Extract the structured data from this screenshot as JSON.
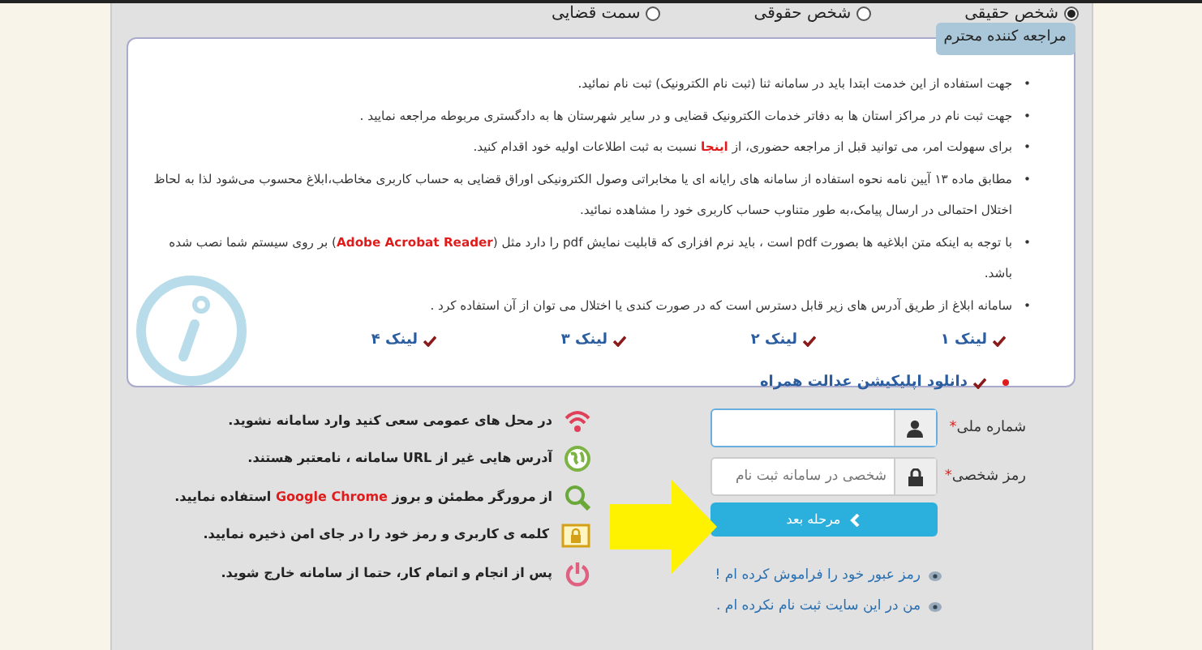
{
  "radios": [
    {
      "label": "شخص حقیقی",
      "selected": true
    },
    {
      "label": "شخص حقوقی",
      "selected": false
    },
    {
      "label": "سمت قضایی",
      "selected": false
    }
  ],
  "notice": {
    "title": "مراجعه کننده محترم",
    "bullet_marker": "•",
    "bullets": [
      {
        "text": "جهت استفاده از این خدمت ابتدا باید در سامانه ثنا (ثبت نام الکترونیک) ثبت نام نمائید."
      },
      {
        "text": "جهت ثبت نام در مراکز استان ها به دفاتر خدمات الکترونیک قضایی و در سایر شهرستان ها به دادگستری مربوطه مراجعه نمایید ."
      },
      {
        "text": "برای سهولت امر، می توانید قبل از مراجعه حضوری، از",
        "link": "اینجا",
        "text_after": "نسبت به ثبت اطلاعات اولیه خود اقدام کنید."
      },
      {
        "text": "مطابق ماده ۱۳ آیین نامه نحوه استفاده از سامانه های رایانه ای یا مخابراتی وصول الکترونیکی اوراق قضایی به حساب کاربری مخاطب،ابلاغ محسوب می‌شود لذا به لحاظ اختلال احتمالی در ارسال پیامک،به طور متناوب حساب کاربری خود را مشاهده نمائید."
      },
      {
        "text": "با توجه به اینکه متن ابلاغیه ها بصورت pdf است ، باید نرم افزاری که قابلیت نمایش pdf را دارد مثل (**Adobe Acrobat Reader**) بر روی سیستم شما نصب شده باشد."
      },
      {
        "text": "سامانه ابلاغ از طریق آدرس های زیر قابل دسترس است که در صورت کندی یا اختلال می توان از آن استفاده کرد ."
      }
    ],
    "links": [
      "لینک ۱",
      "لینک ۲",
      "لینک ۳",
      "لینک ۴"
    ],
    "app_link": "دانلود اپلیکیشن عدالت همراه"
  },
  "login": {
    "fields": [
      {
        "label": "شماره ملی",
        "required_mark": "*",
        "kind": "user"
      },
      {
        "label": "رمز شخصی",
        "required_mark": "*",
        "kind": "lock",
        "placeholder": "شخصی در سامانه ثبت نام"
      }
    ],
    "button": "مرحله بعد",
    "help_links": [
      "رمز عبور خود را فراموش کرده ام !",
      "من در این سایت ثبت نام نکرده ام ."
    ]
  },
  "tips": [
    {
      "kind": "wifi",
      "text": "در محل های عمومی سعی کنید وارد سامانه نشوید."
    },
    {
      "kind": "globe",
      "text": "آدرس هایی غیر از URL سامانه ، نامعتبر هستند."
    },
    {
      "kind": "search",
      "text": "از مرورگر مطمئن و بروز **Google Chrome** استفاده نمایید."
    },
    {
      "kind": "lock",
      "text": "کلمه ی کاربری و رمز خود را در جای امن ذخیره نمایید."
    },
    {
      "kind": "power",
      "text": "پس از انجام و اتمام کار، حتما از سامانه خارج شوید."
    }
  ]
}
